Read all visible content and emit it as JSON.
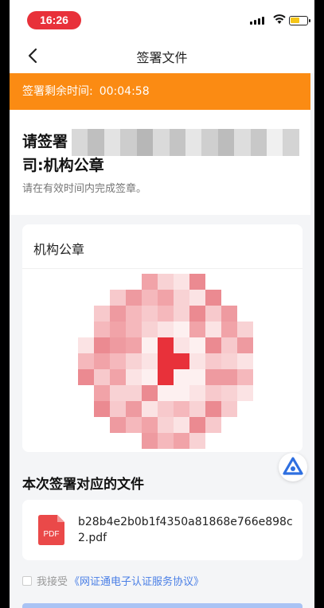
{
  "status_bar": {
    "time": "16:26",
    "accent": "#e8313a",
    "battery_level": 0.6,
    "icons": [
      "signal-icon",
      "wifi-icon",
      "battery-icon"
    ]
  },
  "nav": {
    "title": "签署文件",
    "back_icon": "back-arrow-icon"
  },
  "timer": {
    "label": "签署剩余时间:",
    "value": "00:04:58",
    "color": "#fb8b13"
  },
  "request": {
    "title_prefix": "请签署",
    "title_line2": "司:机构公章",
    "hint": "请在有效时间内完成签章。"
  },
  "seal_card": {
    "title": "机构公章",
    "seal_color": "#e8313a"
  },
  "files": {
    "title": "本次签署对应的文件",
    "items": [
      {
        "icon": "pdf-file-icon",
        "icon_label": "PDF",
        "name": "b28b4e2b0b1f4350a81868e766e898c2.pdf"
      }
    ]
  },
  "agreement": {
    "checked": false,
    "text": "我接受",
    "link": "《网证通电子认证服务协议》"
  },
  "colors": {
    "primary": "#4a7fe6",
    "submit_disabled": "#a9c3f4"
  }
}
